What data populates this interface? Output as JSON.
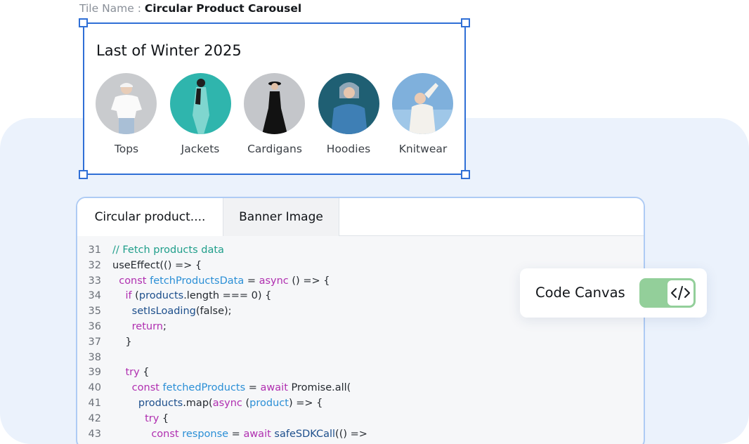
{
  "tile_name": {
    "prefix": "Tile Name : ",
    "value": "Circular Product Carousel"
  },
  "tile": {
    "title": "Last of Winter 2025",
    "categories": [
      {
        "label": "Tops"
      },
      {
        "label": "Jackets"
      },
      {
        "label": "Cardigans"
      },
      {
        "label": "Hoodies"
      },
      {
        "label": "Knitwear"
      }
    ]
  },
  "editor": {
    "tabs": [
      {
        "label": "Circular product...."
      },
      {
        "label": "Banner Image"
      }
    ],
    "lines": [
      {
        "n": "31",
        "tokens": [
          [
            "// Fetch products data",
            "cm"
          ]
        ]
      },
      {
        "n": "32",
        "tokens": [
          [
            "useEffect(() => {",
            "tx"
          ]
        ]
      },
      {
        "n": "33",
        "tokens": [
          [
            "  ",
            "tx"
          ],
          [
            "const",
            "kw"
          ],
          [
            " ",
            "tx"
          ],
          [
            "fetchProductsData",
            "fn"
          ],
          [
            " = ",
            "tx"
          ],
          [
            "async",
            "kw"
          ],
          [
            " () => {",
            "tx"
          ]
        ]
      },
      {
        "n": "34",
        "tokens": [
          [
            "    ",
            "tx"
          ],
          [
            "if",
            "kw"
          ],
          [
            " (",
            "tx"
          ],
          [
            "products",
            "id"
          ],
          [
            ".length === 0) {",
            "tx"
          ]
        ]
      },
      {
        "n": "35",
        "tokens": [
          [
            "      ",
            "tx"
          ],
          [
            "setIsLoading",
            "id"
          ],
          [
            "(false);",
            "tx"
          ]
        ]
      },
      {
        "n": "36",
        "tokens": [
          [
            "      ",
            "tx"
          ],
          [
            "return",
            "kw"
          ],
          [
            ";",
            "tx"
          ]
        ]
      },
      {
        "n": "37",
        "tokens": [
          [
            "    }",
            "tx"
          ]
        ]
      },
      {
        "n": "38",
        "tokens": []
      },
      {
        "n": "39",
        "tokens": [
          [
            "    ",
            "tx"
          ],
          [
            "try",
            "kw"
          ],
          [
            " {",
            "tx"
          ]
        ]
      },
      {
        "n": "40",
        "tokens": [
          [
            "      ",
            "tx"
          ],
          [
            "const",
            "kw"
          ],
          [
            " ",
            "tx"
          ],
          [
            "fetchedProducts",
            "fn"
          ],
          [
            " = ",
            "tx"
          ],
          [
            "await",
            "kw"
          ],
          [
            " Promise.all(",
            "tx"
          ]
        ]
      },
      {
        "n": "41",
        "tokens": [
          [
            "        ",
            "tx"
          ],
          [
            "products",
            "id"
          ],
          [
            ".map(",
            "tx"
          ],
          [
            "async",
            "kw"
          ],
          [
            " (",
            "tx"
          ],
          [
            "product",
            "fn"
          ],
          [
            ") => {",
            "tx"
          ]
        ]
      },
      {
        "n": "42",
        "tokens": [
          [
            "          ",
            "tx"
          ],
          [
            "try",
            "kw"
          ],
          [
            " {",
            "tx"
          ]
        ]
      },
      {
        "n": "43",
        "tokens": [
          [
            "            ",
            "tx"
          ],
          [
            "const",
            "kw"
          ],
          [
            " ",
            "tx"
          ],
          [
            "response",
            "fn"
          ],
          [
            " = ",
            "tx"
          ],
          [
            "await",
            "kw"
          ],
          [
            " ",
            "tx"
          ],
          [
            "safeSDKCall",
            "id"
          ],
          [
            "(() =>",
            "tx"
          ]
        ]
      }
    ]
  },
  "code_canvas": {
    "label": "Code Canvas",
    "toggle_on": true,
    "toggle_icon": "code-brackets-icon"
  },
  "colors": {
    "accent_border": "#2f6fd6",
    "panel_bg": "#ebf2fc",
    "toggle_green": "#93cf9a",
    "comment": "#1f9e8a",
    "keyword": "#b02fb0",
    "function": "#2b8fd6",
    "identifier": "#1d4f8c"
  }
}
